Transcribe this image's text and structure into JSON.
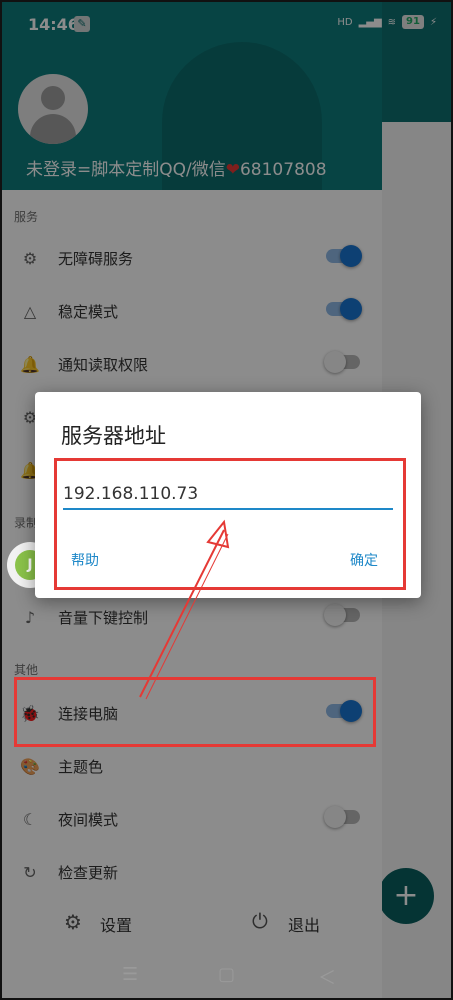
{
  "status_bar": {
    "time": "14:46",
    "signal": "HD",
    "battery": "91"
  },
  "drawer": {
    "user_text_prefix": "未登录=脚本定制QQ/微信",
    "user_text_suffix": "68107808",
    "sections": {
      "services": "服务",
      "record": "录制",
      "other": "其他"
    },
    "items": {
      "accessibility": {
        "label": "无障碍服务",
        "icon": "gear-icon",
        "enabled": true
      },
      "stable": {
        "label": "稳定模式",
        "icon": "triangle-icon",
        "enabled": true
      },
      "notification": {
        "label": "通知读取权限",
        "icon": "bell-icon",
        "enabled": false
      },
      "volume": {
        "label": "音量下键控制",
        "icon": "sound-icon",
        "enabled": false
      },
      "connect_pc": {
        "label": "连接电脑",
        "icon": "bug-icon",
        "enabled": true
      },
      "theme": {
        "label": "主题色",
        "icon": "palette-icon"
      },
      "night": {
        "label": "夜间模式",
        "icon": "moon-icon",
        "enabled": false
      },
      "update": {
        "label": "检查更新",
        "icon": "refresh-icon"
      }
    },
    "bottom": {
      "settings": "设置",
      "exit": "退出"
    }
  },
  "dialog": {
    "title": "服务器地址",
    "input_value": "192.168.110.73",
    "help": "帮助",
    "confirm": "确定"
  },
  "colors": {
    "accent": "#1976d2",
    "header": "#0e7c7c",
    "highlight": "#e53935"
  }
}
